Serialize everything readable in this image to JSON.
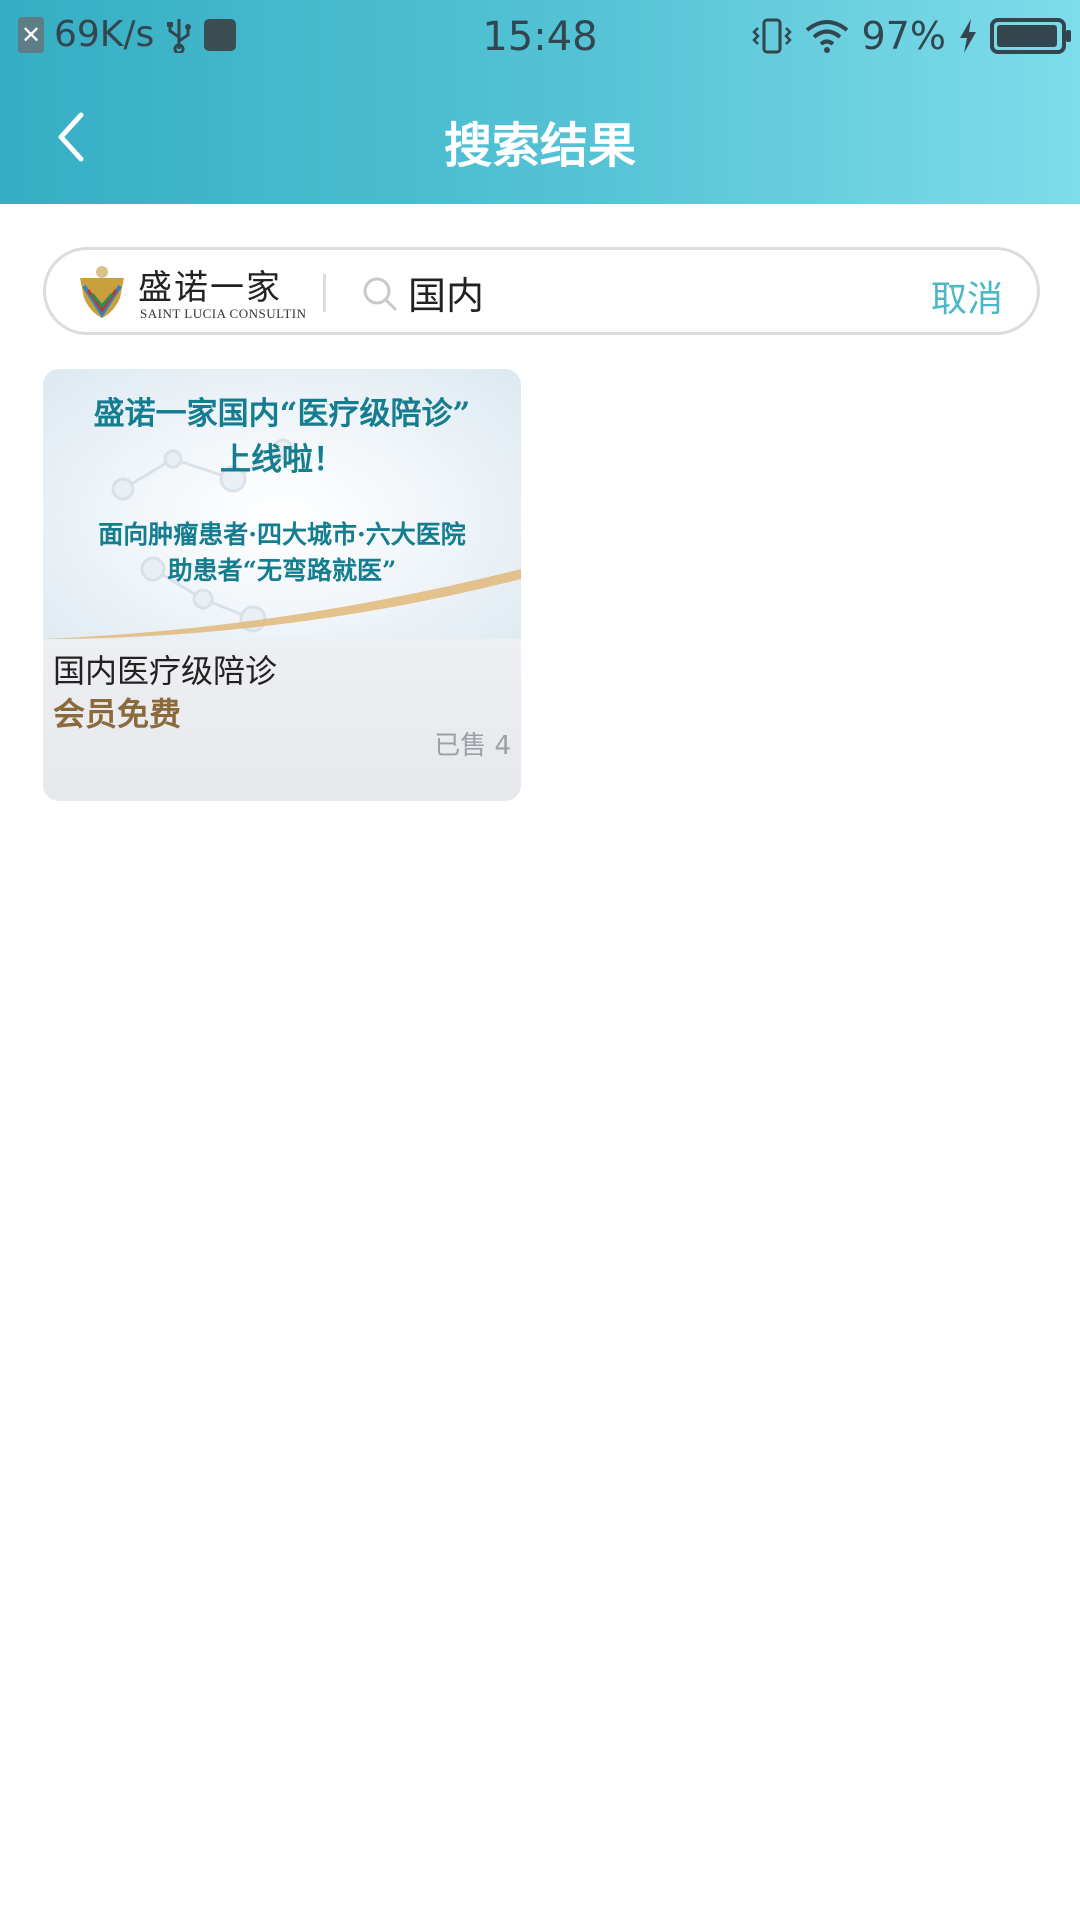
{
  "status_bar": {
    "net_speed": "69K/s",
    "time": "15:48",
    "battery_percent": "97%",
    "battery_level": 0.97,
    "icons": [
      "sim-absent-icon",
      "usb-icon",
      "usb-debug-icon",
      "vibrate-icon",
      "wifi-icon",
      "charging-icon",
      "battery-icon"
    ]
  },
  "nav": {
    "title": "搜索结果",
    "back_icon": "chevron-left-icon"
  },
  "search": {
    "brand_name": "盛诺一家",
    "brand_subtitle": "SAINT LUCIA CONSULTIN",
    "query": "国内",
    "cancel_label": "取消",
    "icon": "search-icon"
  },
  "results": [
    {
      "banner_headline_1": "盛诺一家国内“医疗级陪诊”",
      "banner_headline_2": "上线啦！",
      "banner_subline_1": "面向肿瘤患者·四大城市·六大医院",
      "banner_subline_2": "助患者“无弯路就医”",
      "title": "国内医疗级陪诊",
      "price": "会员免费",
      "sold": "已售 4"
    }
  ],
  "colors": {
    "header_start": "#35aec3",
    "header_end": "#7fdcea",
    "accent": "#4bb8c8",
    "price": "#8a6a3a",
    "banner_text": "#157d90"
  }
}
